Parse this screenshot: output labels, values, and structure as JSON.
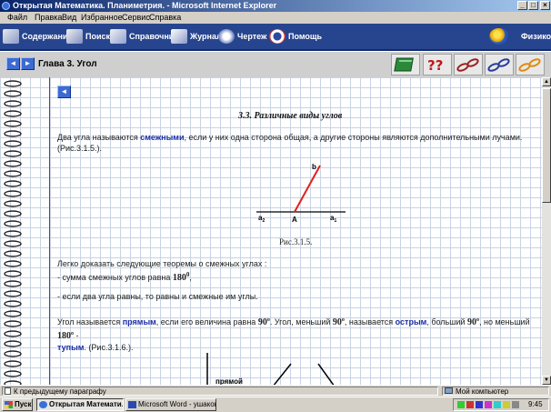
{
  "window": {
    "title": "Открытая Математика. Планиметрия. - Microsoft Internet Explorer",
    "minimize": "_",
    "maximize": "□",
    "close": "×"
  },
  "menu": [
    "Файл",
    "Правка",
    "Вид",
    "Избранное",
    "Сервис",
    "Справка"
  ],
  "app_toolbar": {
    "items": [
      "Содержание",
      "Поиск",
      "Справочник",
      "Журнал",
      "Чертеж",
      "Помощь"
    ],
    "brand": "Физикон"
  },
  "chapter_bar": {
    "prev": "◄",
    "next": "►",
    "title": "Глава 3. Угол"
  },
  "content": {
    "back_arrow": "◄",
    "section_title": "3.3. Различные виды углов",
    "p1": {
      "before": "Два угла называются ",
      "term": "смежными",
      "after": ", если у них одна сторона общая, а другие стороны являются дополнительными лучами.",
      "ref": "(Рис.3.1.5.)."
    },
    "figure": {
      "label_b": "b",
      "label_a2": "a",
      "label_a2_sub": "2",
      "label_A": "A",
      "label_a1": "a",
      "label_a1_sub": "1",
      "caption": "Рис.3.1.5."
    },
    "theorems": {
      "intro": "Легко доказать следующие теоремы о смежных углах :",
      "t1": "- сумма смежных углов равна ",
      "t1_num": "180",
      "t1_sup": "0",
      "t1_end": ",",
      "t2": "- если два угла равны, то равны и смежные им углы."
    },
    "p3": {
      "a": "Угол называется ",
      "right": "прямым",
      "b": ", если его величина равна ",
      "n90": "90",
      "deg": "o",
      "c": ". Угол, меньший ",
      "d": ", называется ",
      "acute": "острым",
      "e": ", больший ",
      "f": ", но меньший ",
      "n180": "180",
      "g": " -",
      "obtuse": "тупым",
      "h": ". (Рис.3.1.6.)."
    },
    "fig2_label": "прямой"
  },
  "status_bar": {
    "text": "К предыдущему параграфу",
    "zone": "Мой компьютер"
  },
  "taskbar": {
    "start": "Пуск",
    "tasks": [
      "Открытая Математи...",
      "Microsoft Word - ушаков.d..."
    ],
    "clock": "9:45"
  },
  "colors": {
    "title_gradient_start": "#0a246a",
    "toolbar_bg": "#27458e",
    "term_blue": "#1c2ea5",
    "margin_red": "#c81e1e",
    "figure_ray": "#e02020"
  }
}
